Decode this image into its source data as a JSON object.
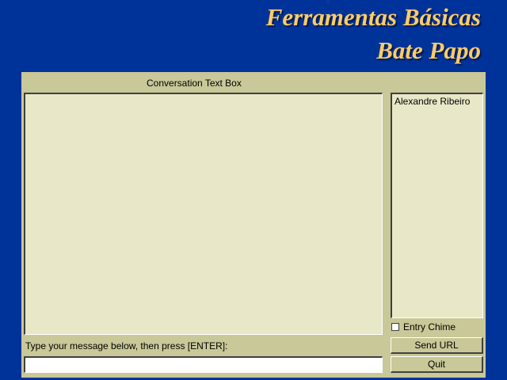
{
  "slide": {
    "title_line1": "Ferramentas Básicas",
    "title_line2": "Bate Papo"
  },
  "chat": {
    "conversation_label": "Conversation Text Box",
    "conversation_text": "",
    "users": [
      "Alexandre Ribeiro"
    ],
    "entry_chime_label": "Entry Chime",
    "entry_chime_checked": false,
    "message_prompt": "Type your message below, then press [ENTER]:",
    "message_value": "",
    "send_url_label": "Send URL",
    "quit_label": "Quit"
  },
  "colors": {
    "background": "#003399",
    "title": "#ffcc66",
    "panel": "#c8c898",
    "textbox": "#e8e8c8"
  }
}
